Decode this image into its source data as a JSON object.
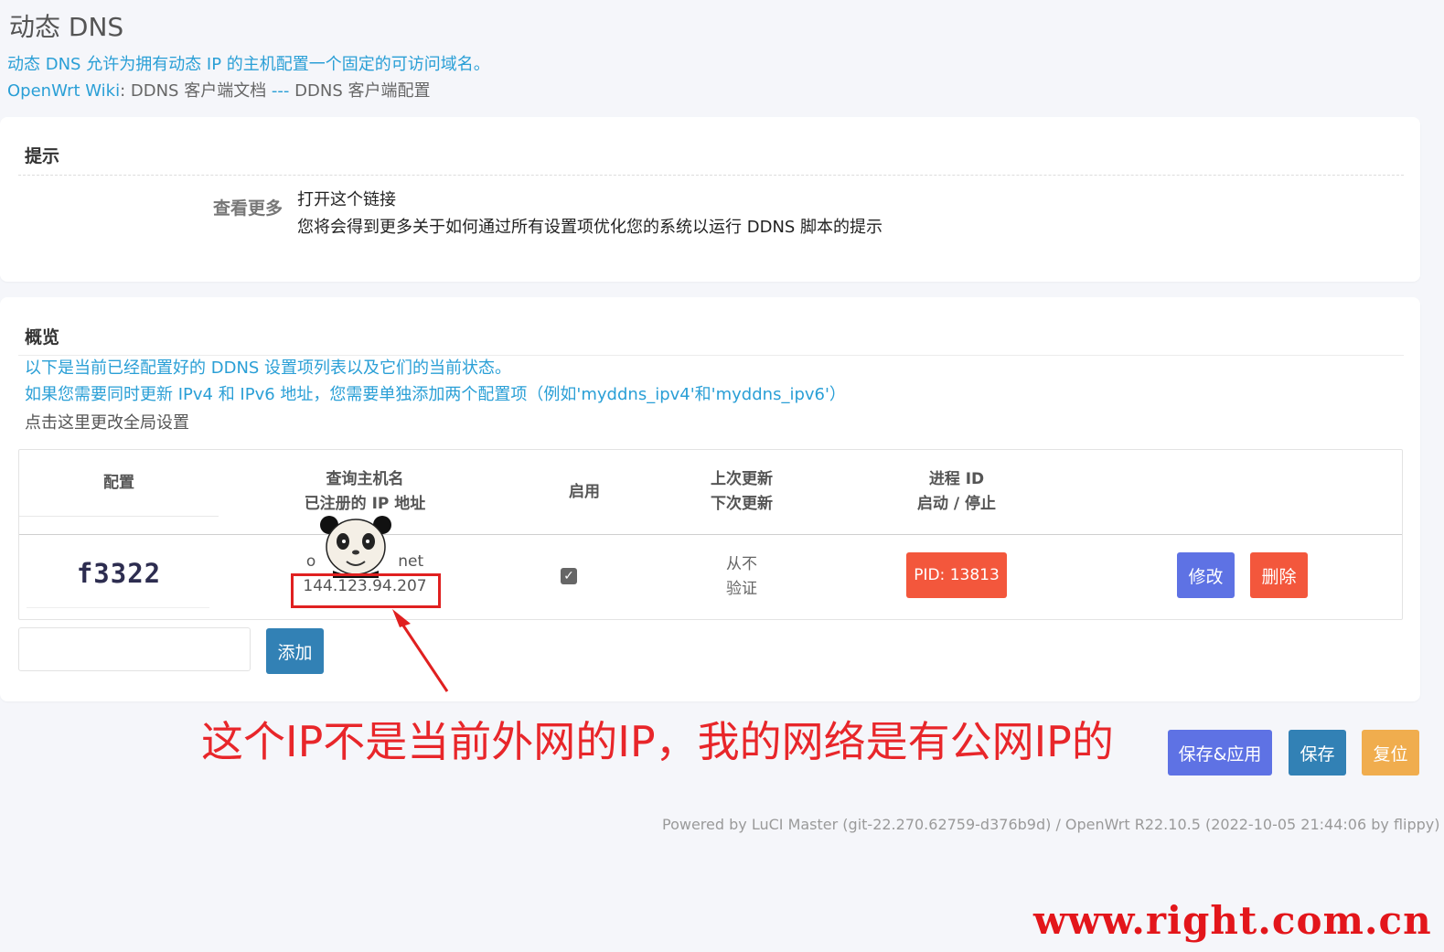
{
  "page": {
    "title": "动态 DNS",
    "description": "动态 DNS 允许为拥有动态 IP 的主机配置一个固定的可访问域名。",
    "wiki_link": "OpenWrt Wiki",
    "wiki_tail_1": ": DDNS 客户端文档 ",
    "wiki_sep": "---",
    "wiki_tail_2": " DDNS 客户端配置"
  },
  "tips": {
    "title": "提示",
    "label": "查看更多",
    "link_text": "打开这个链接",
    "detail": "您将会得到更多关于如何通过所有设置项优化您的系统以运行 DDNS 脚本的提示"
  },
  "overview": {
    "title": "概览",
    "line1": "以下是当前已经配置好的 DDNS 设置项列表以及它们的当前状态。",
    "line2": "如果您需要同时更新 IPv4 和 IPv6 地址，您需要单独添加两个配置项（例如'myddns_ipv4'和'myddns_ipv6'）",
    "line3": "点击这里更改全局设置",
    "headers": {
      "config": "配置",
      "host_1": "查询主机名",
      "host_2": "已注册的 IP 地址",
      "enable": "启用",
      "update_1": "上次更新",
      "update_2": "下次更新",
      "pid_1": "进程 ID",
      "pid_2": "启动 / 停止"
    },
    "row": {
      "config": "f3322",
      "host_prefix": "o",
      "host_suffix": "net",
      "ip": "144.123.94.207",
      "enabled_mark": "✓",
      "last_update": "从不",
      "next_update": "验证",
      "pid": "PID: 13813",
      "edit": "修改",
      "delete": "删除"
    },
    "add_button": "添加"
  },
  "actions": {
    "save_apply": "保存&应用",
    "save": "保存",
    "reset": "复位"
  },
  "annotation": {
    "text": "这个IP不是当前外网的IP，我的网络是有公网IP的",
    "color": "#e8262a"
  },
  "footer": "Powered by LuCI Master (git-22.270.62759-d376b9d) / OpenWrt R22.10.5 (2022-10-05 21:44:06 by flippy)",
  "watermark": "www.right.com.cn",
  "colors": {
    "link_blue": "#2a9fd6",
    "primary": "#5e72e4",
    "danger": "#f3573c",
    "info": "#3281b5",
    "warning": "#f0ad4e"
  }
}
